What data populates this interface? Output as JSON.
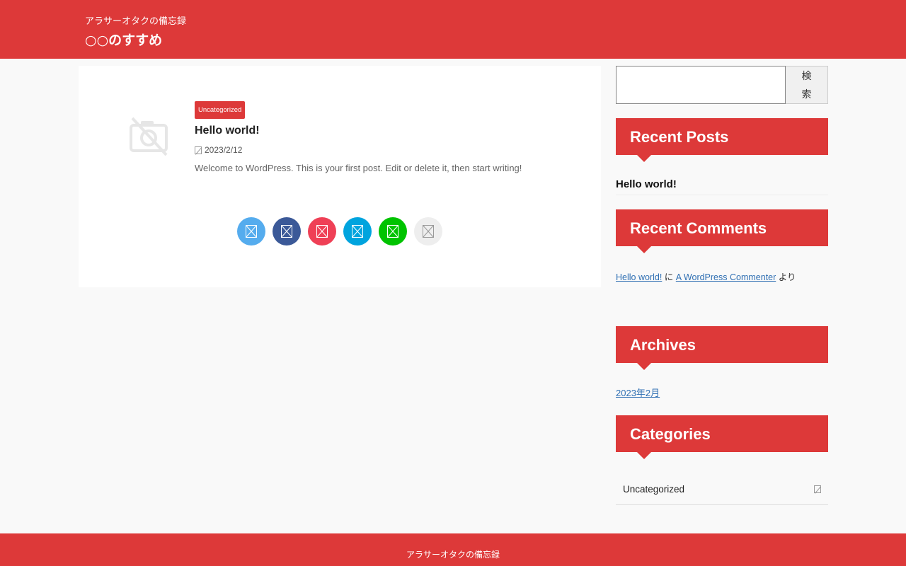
{
  "header": {
    "site_description": "アラサーオタクの備忘録",
    "site_title": "○○のすすめ"
  },
  "post": {
    "category": "Uncategorized",
    "title": "Hello world!",
    "date": "2023/2/12",
    "excerpt": "Welcome to WordPress. This is your first post. Edit or delete it, then start writing!"
  },
  "share_buttons": [
    {
      "name": "twitter",
      "color": "#55acee"
    },
    {
      "name": "facebook",
      "color": "#3b5998"
    },
    {
      "name": "pocket",
      "color": "#ef4056"
    },
    {
      "name": "hatena",
      "color": "#00a4de"
    },
    {
      "name": "line",
      "color": "#00c300"
    },
    {
      "name": "copy",
      "color": "#eeeeee"
    }
  ],
  "sidebar": {
    "search": {
      "placeholder": "",
      "button_label": "検索"
    },
    "recent_posts": {
      "heading": "Recent Posts",
      "items": [
        "Hello world!"
      ]
    },
    "recent_comments": {
      "heading": "Recent Comments",
      "post_link": "Hello world!",
      "connector": "に",
      "author_link": "A WordPress Commenter",
      "suffix": "より"
    },
    "archives": {
      "heading": "Archives",
      "items": [
        "2023年2月"
      ]
    },
    "categories": {
      "heading": "Categories",
      "items": [
        "Uncategorized"
      ]
    }
  },
  "footer": {
    "text": "アラサーオタクの備忘録"
  },
  "colors": {
    "accent": "#dd3939",
    "link": "#2f6fb3",
    "background": "#f9f9f9"
  }
}
